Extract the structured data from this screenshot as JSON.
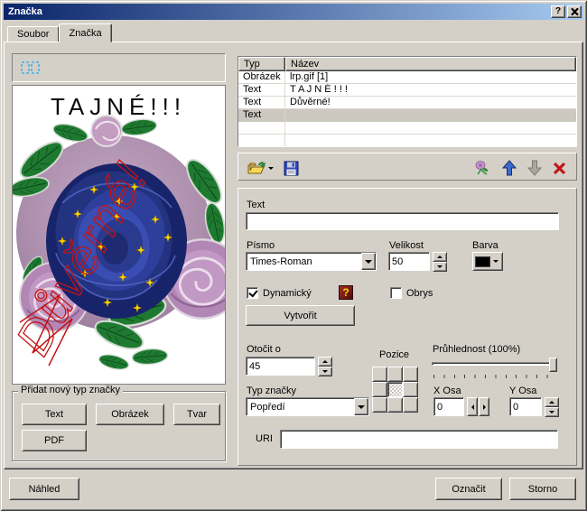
{
  "window": {
    "title": "Značka",
    "help_glyph": "?"
  },
  "tabs": {
    "file": "Soubor",
    "mark": "Značka"
  },
  "preview": {
    "title_text": "TAJNÉ!!!",
    "diagonal_text": "Důvěrné!"
  },
  "marks_table": {
    "columns": {
      "type": "Typ",
      "name": "Název"
    },
    "rows": [
      {
        "type": "Obrázek",
        "name": "lrp.gif [1]"
      },
      {
        "type": "Text",
        "name": "T A J N É ! ! !"
      },
      {
        "type": "Text",
        "name": "Důvěrné!"
      },
      {
        "type": "Text",
        "name": ""
      }
    ]
  },
  "icons": {
    "open": "folder-open-icon",
    "open_dropdown": "chevron-down-icon",
    "save": "floppy-save-icon",
    "mark_preview": "rose-thumbnail-icon",
    "move_up": "arrow-up-icon",
    "move_down": "arrow-down-icon",
    "delete": "red-x-delete-icon",
    "selection": "dashed-rectangles-icon",
    "help": "red-question-icon"
  },
  "form": {
    "text_label": "Text",
    "text_value": "",
    "font_label": "Písmo",
    "font_value": "Times-Roman",
    "size_label": "Velikost",
    "size_value": "50",
    "color_label": "Barva",
    "color_value": "#000000",
    "dynamic_label": "Dynamický",
    "dynamic_checked": true,
    "help_glyph": "?",
    "outline_label": "Obrys",
    "outline_checked": false,
    "create_label": "Vytvořit",
    "rotate_label": "Otočit o",
    "rotate_value": "45",
    "position_label": "Pozice",
    "opacity_label": "Průhlednost (100%)",
    "opacity_percent": 100,
    "type_label": "Typ značky",
    "type_value": "Popředí",
    "x_label": "X Osa",
    "x_value": "0",
    "y_label": "Y Osa",
    "y_value": "0",
    "uri_label": "URI",
    "uri_value": ""
  },
  "add_group": {
    "title": "Přidat nový typ značky",
    "buttons": {
      "text": "Text",
      "image": "Obrázek",
      "shape": "Tvar",
      "pdf": "PDF"
    }
  },
  "footer": {
    "preview": "Náhled",
    "select": "Označit",
    "cancel": "Storno"
  },
  "colors": {
    "titlebar_start": "#0a246a",
    "titlebar_end": "#a6caf0",
    "dialog_bg": "#d4d0c8",
    "selected_row": "#ccc8c0",
    "color_swatch": "#000000",
    "delete_red": "#c01818",
    "arrow_blue": "#3a6ad0"
  }
}
